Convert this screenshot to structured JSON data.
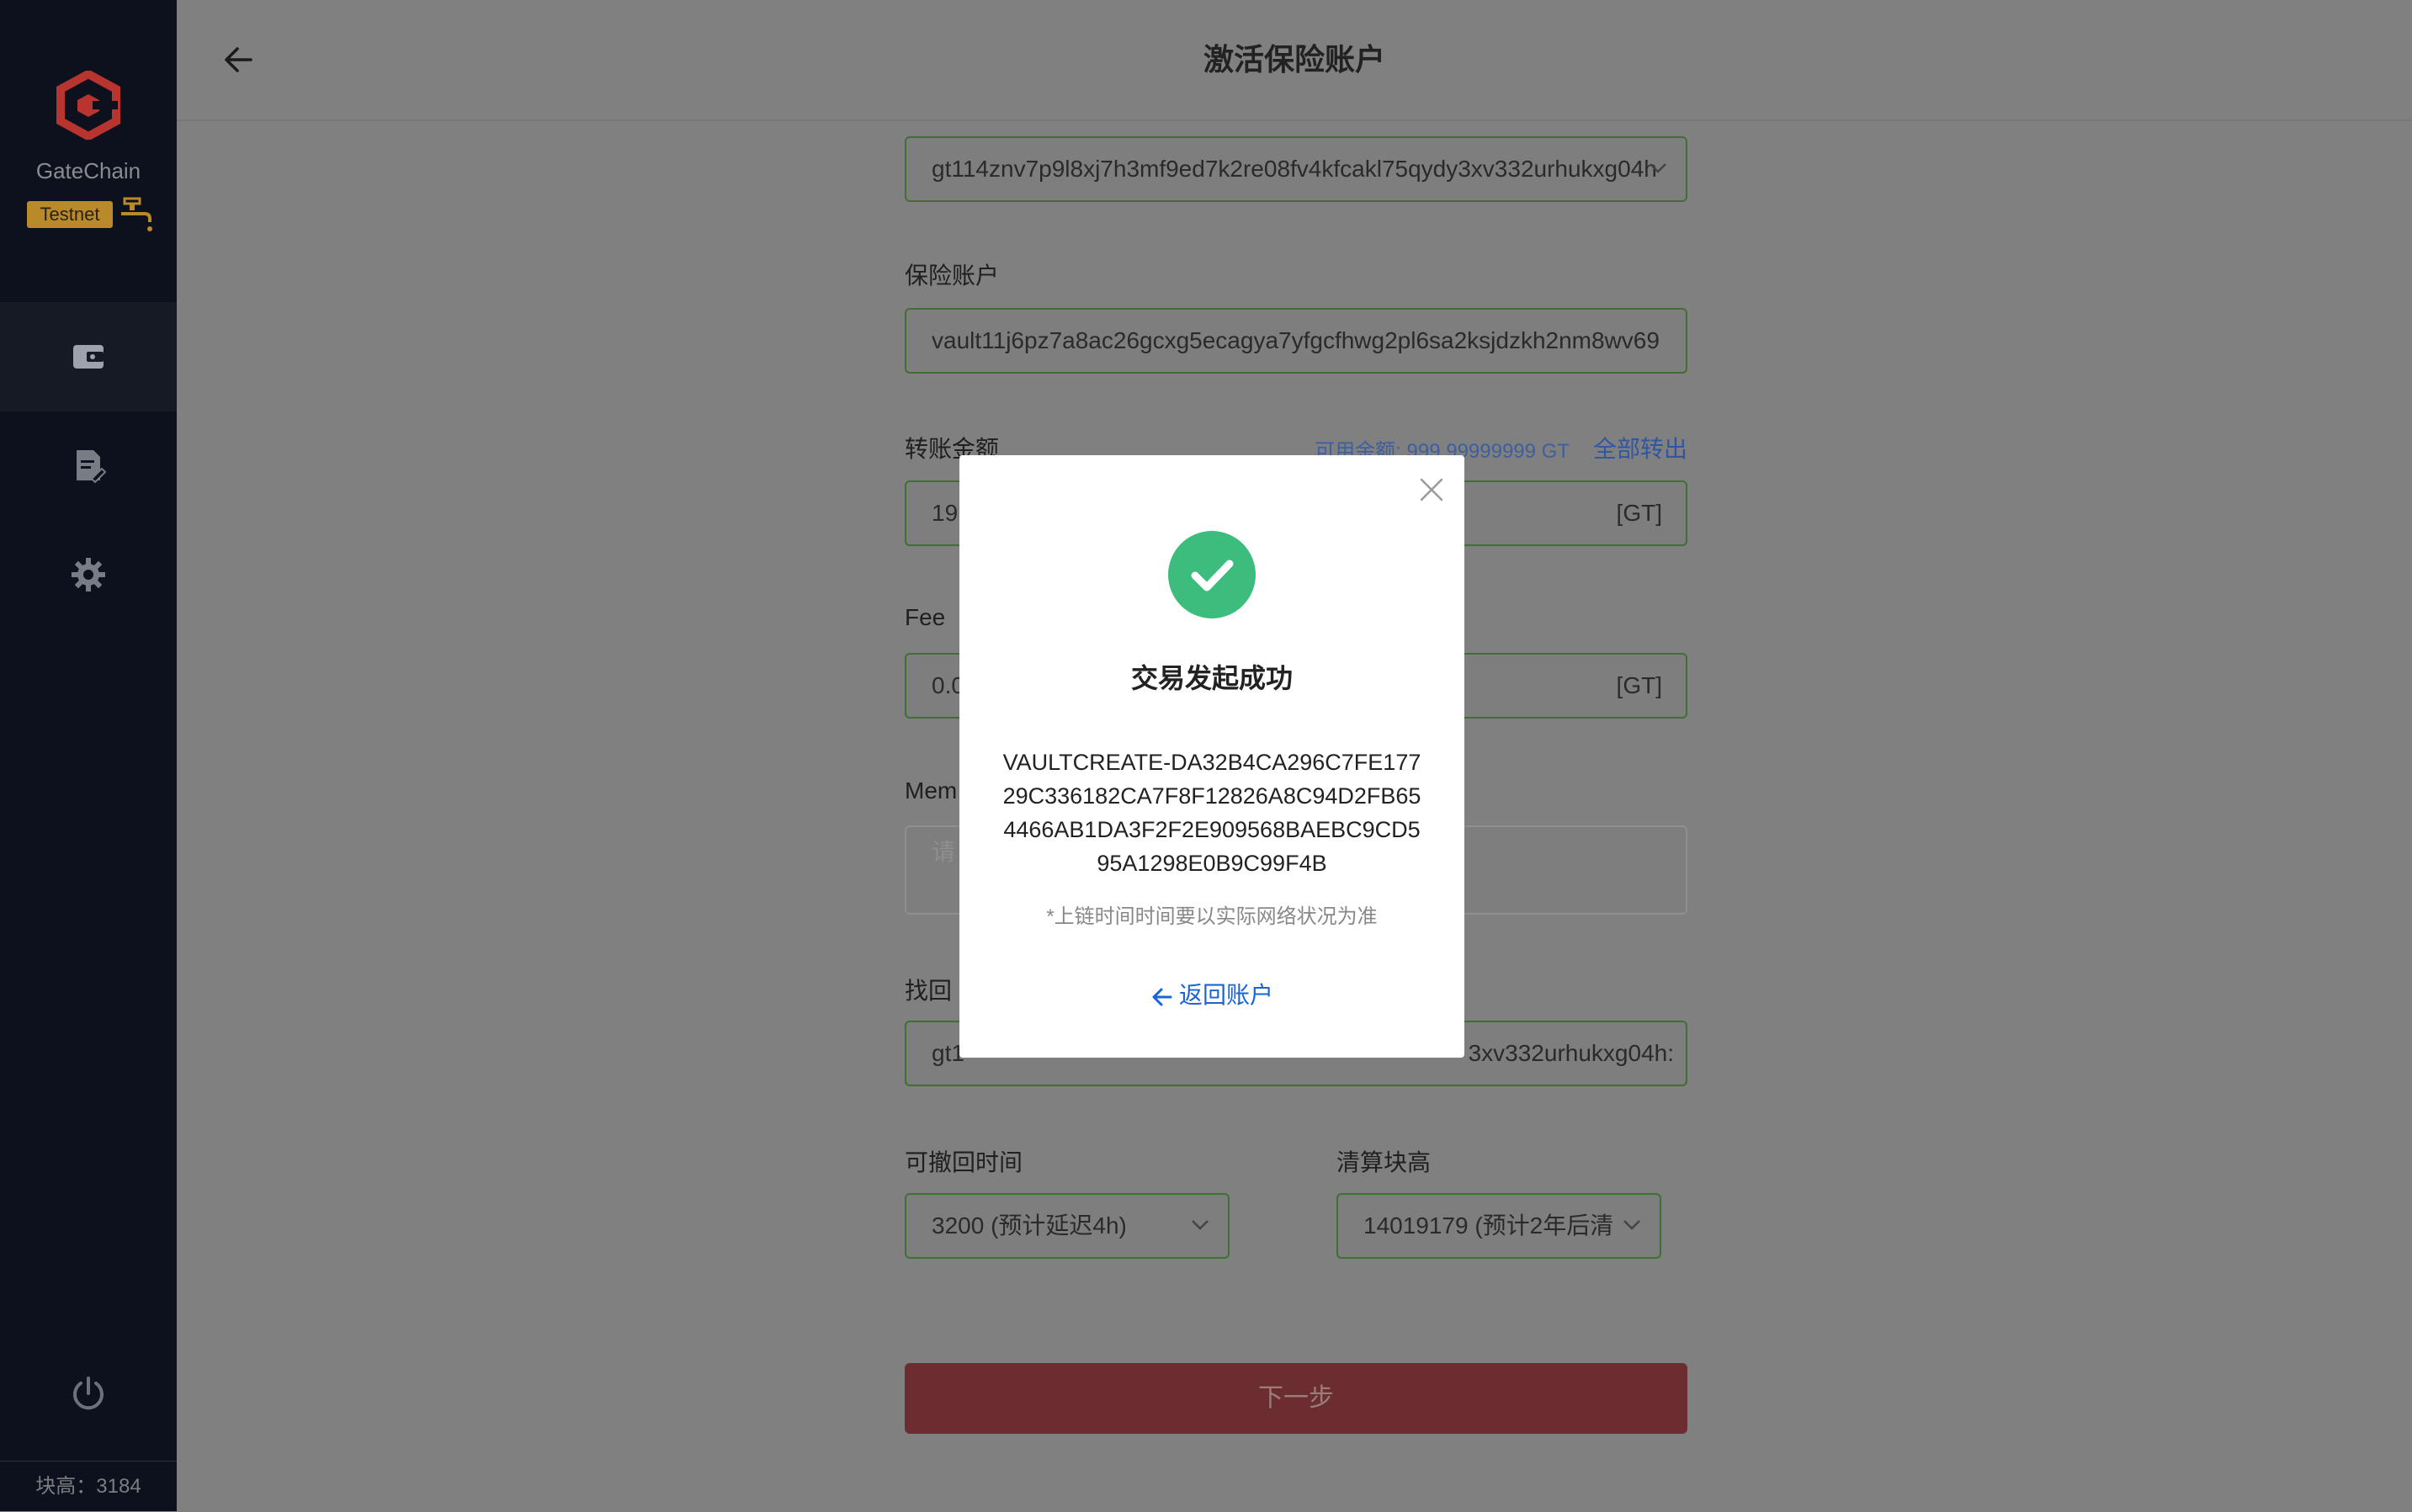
{
  "sidebar": {
    "brand": "GateChain",
    "network_badge": "Testnet",
    "nav": [
      {
        "icon": "wallet-icon",
        "active": true
      },
      {
        "icon": "document-edit-icon",
        "active": false
      },
      {
        "icon": "gear-icon",
        "active": false
      }
    ],
    "block_height_label": "块高：3184"
  },
  "header": {
    "title": "激活保险账户"
  },
  "form": {
    "from_address": "gt114znv7p9l8xj7h3mf9ed7k2re08fv4kfcakl75qydy3xv332urhukxg04h",
    "vault_label": "保险账户",
    "vault_address": "vault11j6pz7a8ac26gcxg5ecagya7yfgcfhwg2pl6sa2ksjdzkh2nm8wv69",
    "amount_label": "转账金额",
    "balance_text": "可用余额: 999.99999999 GT",
    "all_out": "全部转出",
    "amount_value_partial": "19",
    "unit": "[GT]",
    "fee_label": "Fee",
    "fee_value_partial": "0.0",
    "memo_label_partial": "Mem",
    "memo_placeholder_partial": "请",
    "retrieve_label_partial": "找回",
    "retrieve_address_left": "gt1",
    "retrieve_address_right": "3xv332urhukxg04h:",
    "revoke_time_label": "可撤回时间",
    "revoke_time_value": "3200 (预计延迟4h)",
    "clear_height_label": "清算块高",
    "clear_height_value": "14019179 (预计2年后清",
    "next_button": "下一步"
  },
  "modal": {
    "title": "交易发起成功",
    "tx_hash": "VAULTCREATE-DA32B4CA296C7FE17729C336182CA7F8F12826A8C94D2FB654466AB1DA3F2F2E909568BAEBC9CD595A1298E0B9C99F4B",
    "note": "*上链时间时间要以实际网络状况为准",
    "return_link": "返回账户",
    "success_color": "#3dbd7d",
    "link_color": "#1a64d6"
  }
}
